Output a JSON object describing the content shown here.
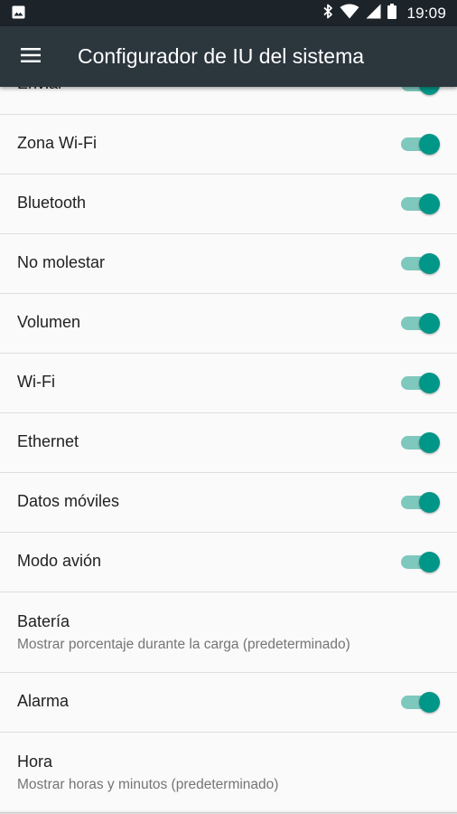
{
  "status_bar": {
    "time": "19:09",
    "icons": [
      "image-notification-icon",
      "bluetooth-icon",
      "wifi-icon",
      "cell-signal-icon",
      "battery-icon"
    ]
  },
  "app_bar": {
    "menu_icon": "hamburger-menu-icon",
    "title": "Configurador de IU del sistema"
  },
  "settings": [
    {
      "label": "Enviar",
      "type": "switch",
      "on": true
    },
    {
      "label": "Zona Wi-Fi",
      "type": "switch",
      "on": true
    },
    {
      "label": "Bluetooth",
      "type": "switch",
      "on": true
    },
    {
      "label": "No molestar",
      "type": "switch",
      "on": true
    },
    {
      "label": "Volumen",
      "type": "switch",
      "on": true
    },
    {
      "label": "Wi-Fi",
      "type": "switch",
      "on": true
    },
    {
      "label": "Ethernet",
      "type": "switch",
      "on": true
    },
    {
      "label": "Datos móviles",
      "type": "switch",
      "on": true
    },
    {
      "label": "Modo avión",
      "type": "switch",
      "on": true
    },
    {
      "label": "Batería",
      "type": "summary",
      "summary": "Mostrar porcentaje durante la carga (predeterminado)"
    },
    {
      "label": "Alarma",
      "type": "switch",
      "on": true
    },
    {
      "label": "Hora",
      "type": "summary",
      "summary": "Mostrar horas y minutos (predeterminado)"
    }
  ],
  "colors": {
    "status_bar": "#1c242a",
    "app_bar": "#2b363d",
    "accent": "#009688",
    "track": "#7ec8bd",
    "background": "#fafafa",
    "divider": "#dedede"
  }
}
